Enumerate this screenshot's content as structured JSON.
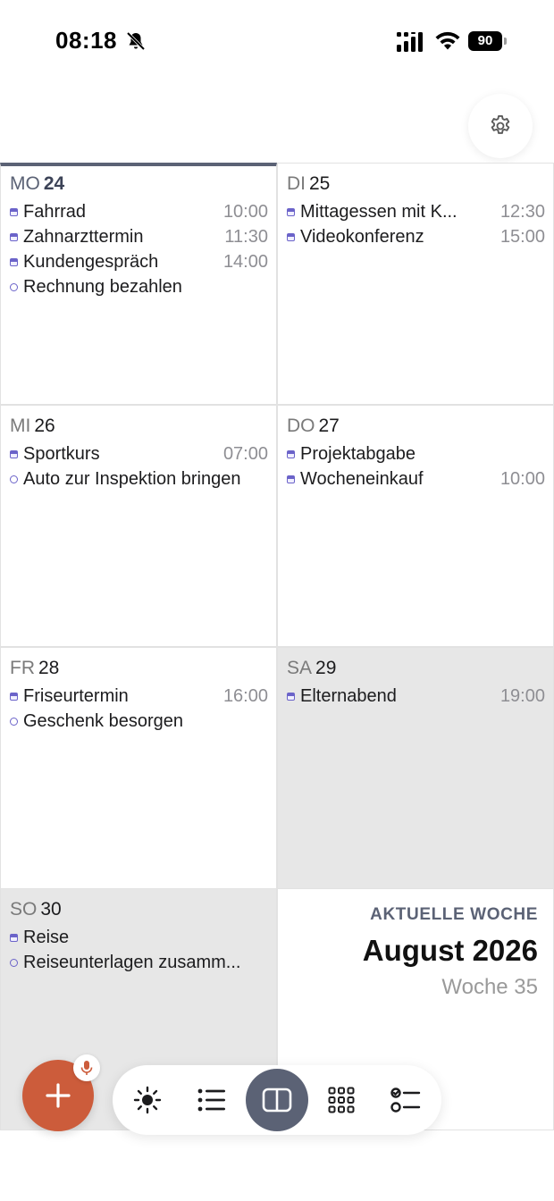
{
  "status_bar": {
    "time": "08:18",
    "battery": "90",
    "icons": [
      "bell-slash-icon",
      "signal-icon",
      "wifi-icon",
      "battery-icon"
    ]
  },
  "settings": {
    "icon": "gear-icon"
  },
  "days": [
    {
      "abbr": "MO",
      "num": "24",
      "events": [
        {
          "type": "calendar",
          "title": "Fahrrad",
          "time": "10:00"
        },
        {
          "type": "calendar",
          "title": "Zahnarzttermin",
          "time": "11:30"
        },
        {
          "type": "calendar",
          "title": "Kundengespräch",
          "time": "14:00"
        },
        {
          "type": "task",
          "title": "Rechnung bezahlen",
          "time": ""
        }
      ]
    },
    {
      "abbr": "DI",
      "num": "25",
      "events": [
        {
          "type": "calendar",
          "title": "Mittagessen mit K...",
          "time": "12:30"
        },
        {
          "type": "calendar",
          "title": "Videokonferenz",
          "time": "15:00"
        }
      ]
    },
    {
      "abbr": "MI",
      "num": "26",
      "events": [
        {
          "type": "calendar",
          "title": "Sportkurs",
          "time": "07:00"
        },
        {
          "type": "task",
          "title": "Auto zur Inspektion bringen",
          "time": ""
        }
      ]
    },
    {
      "abbr": "DO",
      "num": "27",
      "events": [
        {
          "type": "calendar",
          "title": "Projektabgabe",
          "time": ""
        },
        {
          "type": "calendar",
          "title": "Wocheneinkauf",
          "time": "10:00"
        }
      ]
    },
    {
      "abbr": "FR",
      "num": "28",
      "events": [
        {
          "type": "calendar",
          "title": "Friseurtermin",
          "time": "16:00"
        },
        {
          "type": "task",
          "title": "Geschenk besorgen",
          "time": ""
        }
      ]
    },
    {
      "abbr": "SA",
      "num": "29",
      "events": [
        {
          "type": "calendar",
          "title": "Elternabend",
          "time": "19:00"
        }
      ]
    },
    {
      "abbr": "SO",
      "num": "30",
      "events": [
        {
          "type": "calendar",
          "title": "Reise",
          "time": ""
        },
        {
          "type": "task",
          "title": "Reiseunterlagen zusamm...",
          "time": ""
        }
      ]
    }
  ],
  "summary": {
    "label": "AKTUELLE WOCHE",
    "month": "August 2026",
    "week": "Woche 35"
  },
  "bottom_bar": {
    "add_icon": "plus-icon",
    "mic_icon": "microphone-icon",
    "views": [
      {
        "name": "today",
        "icon": "sun-icon",
        "active": false
      },
      {
        "name": "list",
        "icon": "list-icon",
        "active": false
      },
      {
        "name": "week",
        "icon": "split-view-icon",
        "active": true
      },
      {
        "name": "month",
        "icon": "grid-icon",
        "active": false
      },
      {
        "name": "tasks",
        "icon": "checklist-icon",
        "active": false
      }
    ]
  },
  "colors": {
    "accent": "#5b6275",
    "add_button": "#cc5c3b",
    "event_marker": "#6b63c9",
    "weekend_bg": "#e7e7e7"
  }
}
